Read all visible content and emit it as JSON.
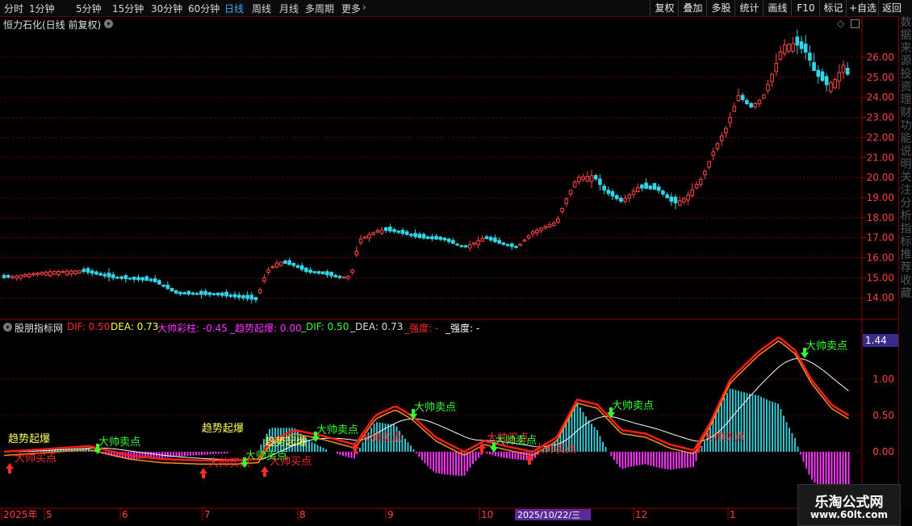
{
  "topbar": {
    "periods": [
      "分时",
      "1分钟",
      "5分钟",
      "15分钟",
      "30分钟",
      "60分钟",
      "日线",
      "周线",
      "月线",
      "多周期",
      "更多"
    ],
    "active_period": "日线",
    "right_buttons": [
      "复权",
      "叠加",
      "多股",
      "统计",
      "画线",
      "F10",
      "标记",
      "+自选",
      "返回"
    ]
  },
  "main_panel": {
    "title": "恒力石化(日线 前复权)",
    "price_ticks": [
      "26.00",
      "25.00",
      "24.00",
      "23.00",
      "22.00",
      "21.00",
      "20.00",
      "19.00",
      "18.00",
      "17.00",
      "16.00",
      "15.00",
      "14.00"
    ]
  },
  "indicator_panel": {
    "name": "股朋指标网",
    "readouts": [
      {
        "text": "DIF: 0.50",
        "color": "#ff2a2a"
      },
      {
        "text": "DEA: 0.73",
        "color": "#ffff33"
      },
      {
        "text": "大帅彩柱: -0.45",
        "color": "#ff33ff"
      },
      {
        "text": "_趋势起爆: 0.00",
        "color": "#ff33ff"
      },
      {
        "text": "_DIF: 0.50",
        "color": "#33ff33"
      },
      {
        "text": "_DEA: 0.73",
        "color": "#dddddd"
      },
      {
        "text": "_强度: -",
        "color": "#ff2a2a"
      },
      {
        "text": "_强度: -",
        "color": "#ffffff"
      }
    ],
    "value_badge": "1.44",
    "value_ticks": [
      "1.00",
      "0.50",
      "0.00"
    ],
    "signals": {
      "trend": "趋势起爆",
      "buy": "大帅买点",
      "sell": "大帅卖点"
    }
  },
  "date_axis": {
    "labels": [
      "2025年",
      "5",
      "6",
      "7",
      "8",
      "9",
      "10",
      "12",
      "1"
    ],
    "cursor_date": "2025/10/22/三"
  },
  "right_strip": {
    "glyphs": [
      "数",
      "据",
      "来",
      "源",
      "投",
      "资",
      "理",
      "财",
      "功",
      "能",
      "说",
      "明",
      "关",
      "注",
      "分",
      "析",
      "指",
      "标",
      "推",
      "荐",
      "收",
      "藏"
    ]
  },
  "watermark": {
    "title": "乐淘公式网",
    "url": "www.60lt.com"
  },
  "colors": {
    "up": "#ff4545",
    "down": "#33d6e8",
    "grid": "#6a0000",
    "dif": "#ff1a1a",
    "dea": "#ffffff",
    "slow": "#ff8c1a",
    "pos_bar": "#33c6d0",
    "neg_bar": "#ff33ff",
    "buy": "#ff2a2a",
    "sell": "#33ff33",
    "label_yellow": "#ffff55"
  },
  "icons": {
    "title_dropdown": "chevron-down-icon",
    "indicator_dropdown": "chevron-down-icon",
    "diamond": "diamond-icon",
    "window": "window-icon",
    "more": "chevron-right-icon"
  }
}
